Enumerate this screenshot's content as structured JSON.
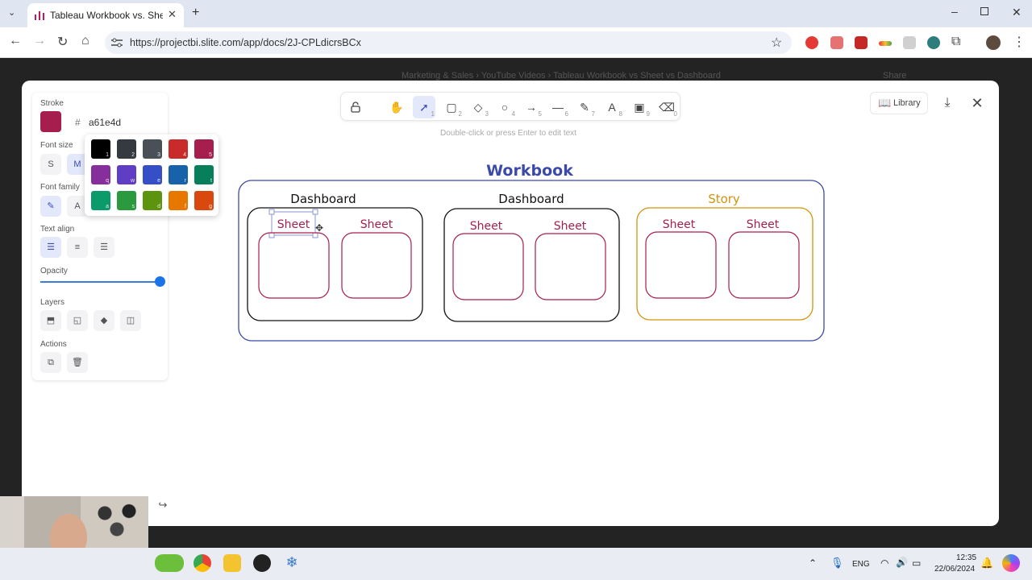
{
  "browser": {
    "tab_title": "Tableau Workbook vs. Sheet vs",
    "url": "https://projectbi.slite.com/app/docs/2J-CPLdicrsBCx"
  },
  "page_behind": {
    "crumb": "Marketing & Sales  ›  YouTube Videos  ›  Tableau Workbook vs Sheet vs Dashboard",
    "share": "Share"
  },
  "toolbar": {
    "tools": [
      {
        "icon": "lock-icon",
        "key": ""
      },
      {
        "icon": "hand-icon",
        "key": ""
      },
      {
        "icon": "select-icon",
        "key": "1"
      },
      {
        "icon": "rectangle-icon",
        "key": "2"
      },
      {
        "icon": "diamond-icon",
        "key": "3"
      },
      {
        "icon": "ellipse-icon",
        "key": "4"
      },
      {
        "icon": "arrow-icon",
        "key": "5"
      },
      {
        "icon": "line-icon",
        "key": "6"
      },
      {
        "icon": "pencil-icon",
        "key": "7"
      },
      {
        "icon": "text-icon",
        "key": "8"
      },
      {
        "icon": "image-icon",
        "key": "9"
      },
      {
        "icon": "eraser-icon",
        "key": "0"
      }
    ],
    "active_tool": "select-icon",
    "hint": "Double-click or press Enter to edit text",
    "library_label": "Library"
  },
  "panel": {
    "stroke_label": "Stroke",
    "stroke_color": "#a61e4d",
    "hash": "#",
    "stroke_hex": "a61e4d",
    "font_size_label": "Font size",
    "font_sizes": [
      "S",
      "M"
    ],
    "font_size_selected": "M",
    "font_family_label": "Font family",
    "text_align_label": "Text align",
    "opacity_label": "Opacity",
    "opacity_value": 1.0,
    "layers_label": "Layers",
    "actions_label": "Actions"
  },
  "picker": {
    "colors": [
      {
        "hex": "#000000",
        "key": "1"
      },
      {
        "hex": "#343a40",
        "key": "2"
      },
      {
        "hex": "#495057",
        "key": "3"
      },
      {
        "hex": "#c92a2a",
        "key": "4"
      },
      {
        "hex": "#a61e4d",
        "key": "5"
      },
      {
        "hex": "#862e9c",
        "key": "q"
      },
      {
        "hex": "#5f3dc4",
        "key": "w"
      },
      {
        "hex": "#364fc7",
        "key": "e"
      },
      {
        "hex": "#1862ab",
        "key": "r"
      },
      {
        "hex": "#087f5b",
        "key": "t"
      },
      {
        "hex": "#0b9b6b",
        "key": "a"
      },
      {
        "hex": "#2b9a3e",
        "key": "s"
      },
      {
        "hex": "#5c940d",
        "key": "d"
      },
      {
        "hex": "#e67700",
        "key": "f"
      },
      {
        "hex": "#d9480f",
        "key": "g"
      }
    ]
  },
  "diagram": {
    "workbook_title": "Workbook",
    "containers": [
      {
        "label": "Dashboard",
        "sheets": [
          "Sheet",
          "Sheet"
        ]
      },
      {
        "label": "Dashboard",
        "sheets": [
          "Sheet",
          "Sheet"
        ]
      },
      {
        "label": "Story",
        "sheets": [
          "Sheet",
          "Sheet"
        ]
      }
    ],
    "colors": {
      "workbook": "#3b4aa8",
      "sheet": "#a61e4d",
      "story": "#d4930c",
      "dashboard": "#111111"
    }
  },
  "taskbar": {
    "lang": "ENG",
    "time": "12:35",
    "date": "22/06/2024"
  }
}
